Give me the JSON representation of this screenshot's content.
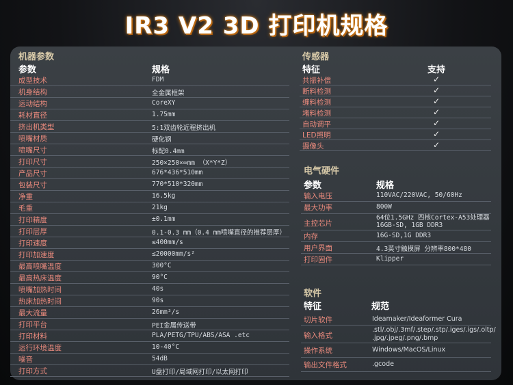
{
  "title": "IR3 V2 3D 打印机规格",
  "machine": {
    "section_title": "机器参数",
    "col_param": "参数",
    "col_spec": "规格",
    "rows": [
      {
        "label": "成型技术",
        "value": "FDM"
      },
      {
        "label": "机身结构",
        "value": "全金属框架"
      },
      {
        "label": "运动结构",
        "value": "CoreXY"
      },
      {
        "label": "耗材直径",
        "value": "1.75mm"
      },
      {
        "label": "挤出机类型",
        "value": "5:1双齿轮近程挤出机"
      },
      {
        "label": "喷嘴材质",
        "value": "硬化钢"
      },
      {
        "label": "喷嘴尺寸",
        "value": "标配0.4mm"
      },
      {
        "label": "打印尺寸",
        "value": "250×250×∞mm （X*Y*Z）"
      },
      {
        "label": "产品尺寸",
        "value": "676*436*510mm"
      },
      {
        "label": "包装尺寸",
        "value": "770*510*320mm"
      },
      {
        "label": "净重",
        "value": "16.5kg"
      },
      {
        "label": "毛重",
        "value": "21kg"
      },
      {
        "label": "打印精度",
        "value": "±0.1mm"
      },
      {
        "label": "打印层厚",
        "value": "0.1-0.3 mm（0.4 mm喷嘴直径的推荐层厚）"
      },
      {
        "label": "打印速度",
        "value": "≤400mm/s"
      },
      {
        "label": "打印加速度",
        "value": "≤20000mm/s²"
      },
      {
        "label": "最高喷嘴温度",
        "value": "300°C"
      },
      {
        "label": "最高热床温度",
        "value": "90°C"
      },
      {
        "label": "喷嘴加热时间",
        "value": "40s"
      },
      {
        "label": "热床加热时间",
        "value": "90s"
      },
      {
        "label": "最大流量",
        "value": "26mm³/s"
      },
      {
        "label": "打印平台",
        "value": "PEI金属传送带"
      },
      {
        "label": "打印材料",
        "value": "PLA/PETG/TPU/ABS/ASA .etc"
      },
      {
        "label": "运行环境温度",
        "value": "10-40°C"
      },
      {
        "label": "噪音",
        "value": "54dB"
      },
      {
        "label": "打印方式",
        "value": "U盘打印/局域网打印/以太网打印"
      }
    ]
  },
  "sensors": {
    "section_title": "传感器",
    "col_feature": "特征",
    "col_support": "支持",
    "check_mark": "✓",
    "rows": [
      {
        "label": "共振补偿"
      },
      {
        "label": "断料检测"
      },
      {
        "label": "缠料检测"
      },
      {
        "label": "堵料检测"
      },
      {
        "label": "自动调平"
      },
      {
        "label": "LED照明"
      },
      {
        "label": "摄像头"
      }
    ]
  },
  "electrical": {
    "section_title": "电气硬件",
    "col_param": "参数",
    "col_spec": "规格",
    "rows": [
      {
        "label": "输入电压",
        "value": "110VAC/220VAC, 50/60Hz"
      },
      {
        "label": "最大功率",
        "value": "800W"
      },
      {
        "label": "主控芯片",
        "value": "64位1.5GHz 四核Cortex-A53处理器",
        "value2": "16GB-SD, 1GB DDR3"
      },
      {
        "label": "内存",
        "value": "16G-SD,1G DDR3"
      },
      {
        "label": "用户界面",
        "value": "4.3英寸触摸屏 分辨率800*480"
      },
      {
        "label": "打印固件",
        "value": "Klipper"
      }
    ]
  },
  "software": {
    "section_title": "软件",
    "col_feature": "特征",
    "col_spec": "规范",
    "rows": [
      {
        "label": "切片软件",
        "value": "Ideamaker/Ideaformer Cura"
      },
      {
        "label": "输入格式",
        "value": ".stl/.obj/.3mf/.step/.stp/.iges/.igs/.oltp/",
        "value2": ".jpg/.jpeg/.png/.bmp"
      },
      {
        "label": "操作系统",
        "value": "Windows/MacOS/Linux"
      },
      {
        "label": "输出文件格式",
        "value": ".gcode"
      }
    ]
  }
}
